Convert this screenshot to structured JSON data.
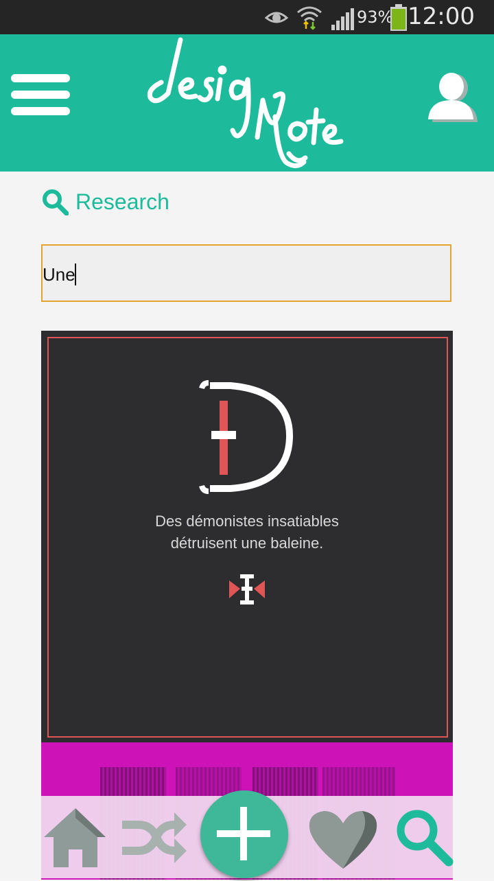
{
  "status_bar": {
    "battery_percent": "93%",
    "time": "12:00",
    "icons": [
      "eye-icon",
      "wifi-icon",
      "signal-icon",
      "battery-icon"
    ]
  },
  "app_bar": {
    "logo_text": "desig Note",
    "menu_icon": "hamburger-menu-icon",
    "profile_icon": "user-profile-icon",
    "background_color": "#1dbb9b"
  },
  "research": {
    "label": "Research",
    "icon": "search-icon"
  },
  "search": {
    "value": "Une"
  },
  "result_card": {
    "tagline_line1": "Des démonistes insatiables",
    "tagline_line2": "détruisent une baleine.",
    "colors": {
      "background": "#2d2c2e",
      "accent": "#e05555"
    }
  },
  "second_card": {
    "color": "#cd12b8"
  },
  "bottom_nav": {
    "items": [
      {
        "icon": "home-icon"
      },
      {
        "icon": "shuffle-icon"
      },
      {
        "icon": "add-icon"
      },
      {
        "icon": "heart-icon"
      },
      {
        "icon": "search-icon"
      }
    ],
    "accent": "#1dbb9b"
  }
}
